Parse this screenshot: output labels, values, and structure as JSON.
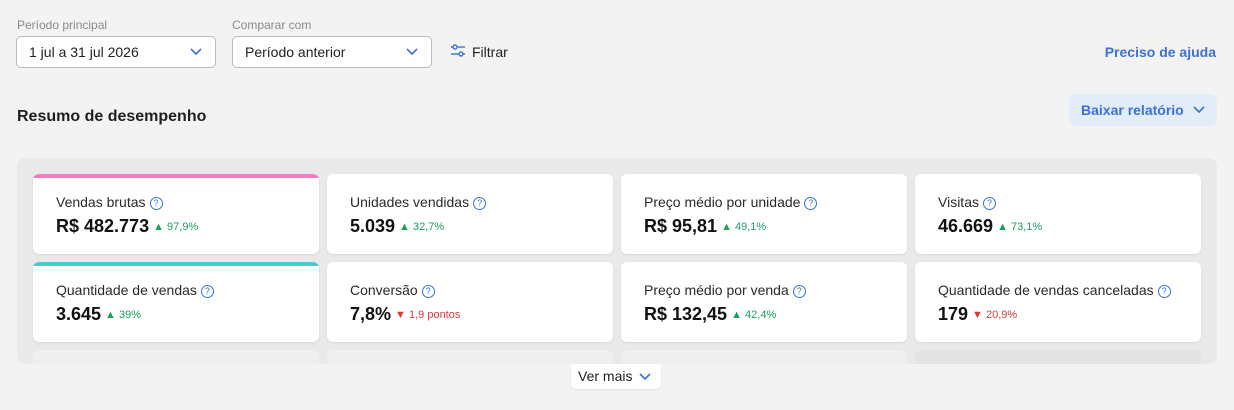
{
  "filters": {
    "period_label": "Período principal",
    "period_value": "1 jul a 31 jul 2026",
    "compare_label": "Comparar com",
    "compare_value": "Período anterior",
    "filter_label": "Filtrar"
  },
  "help_link": "Preciso de ajuda",
  "section": {
    "title": "Resumo de desempenho",
    "download_label": "Baixar relatório"
  },
  "colors": {
    "accent_pink": "#f07cc3",
    "accent_teal": "#3fd0cf",
    "link_blue": "#3a72d9",
    "up_green": "#1e9e5a",
    "down_red": "#d63a3a"
  },
  "metrics": [
    {
      "name": "Vendas brutas",
      "value": "R$ 482.773",
      "delta": "97,9%",
      "trend": "up"
    },
    {
      "name": "Unidades vendidas",
      "value": "5.039",
      "delta": "32,7%",
      "trend": "up"
    },
    {
      "name": "Preço médio por unidade",
      "value": "R$ 95,81",
      "delta": "49,1%",
      "trend": "up"
    },
    {
      "name": "Visitas",
      "value": "46.669",
      "delta": "73,1%",
      "trend": "up"
    },
    {
      "name": "Quantidade de vendas",
      "value": "3.645",
      "delta": "39%",
      "trend": "up"
    },
    {
      "name": "Conversão",
      "value": "7,8%",
      "delta": "1,9 pontos",
      "trend": "down"
    },
    {
      "name": "Preço médio por venda",
      "value": "R$ 132,45",
      "delta": "42,4%",
      "trend": "up"
    },
    {
      "name": "Quantidade de vendas canceladas",
      "value": "179",
      "delta": "20,9%",
      "trend": "down"
    }
  ],
  "see_more": "Ver mais",
  "icons": {
    "up": "▲",
    "down": "▼",
    "help": "?"
  }
}
